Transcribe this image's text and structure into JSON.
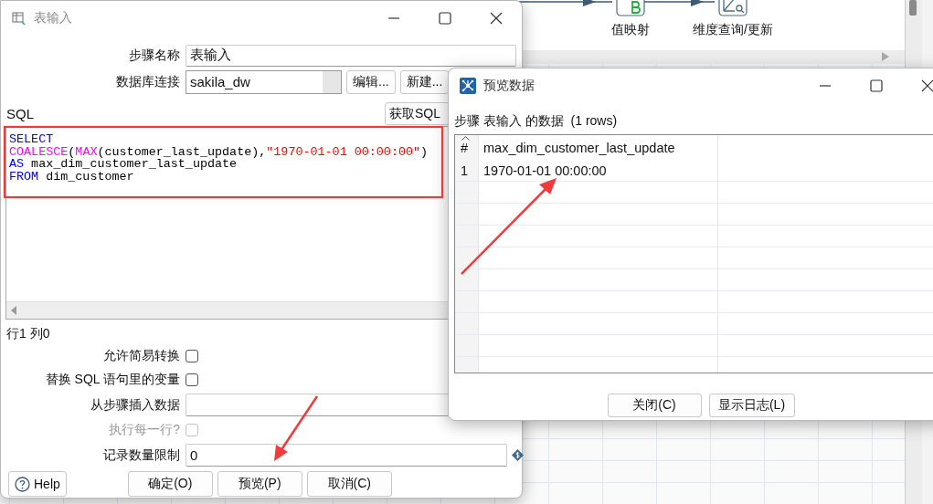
{
  "canvas": {
    "steps": [
      {
        "label": "值映射",
        "kind": "value-mapper"
      },
      {
        "label": "维度查询/更新",
        "kind": "dimension-lookup"
      }
    ]
  },
  "dialog": {
    "title": "表输入",
    "step_name": {
      "label": "步骤名称",
      "value": "表输入"
    },
    "connection": {
      "label": "数据库连接",
      "value": "sakila_dw"
    },
    "connection_buttons": [
      "编辑...",
      "新建..."
    ],
    "sql_label": "SQL",
    "get_sql_button": "获取SQL",
    "sql_lines": [
      [
        {
          "text": "SELECT",
          "kind": "keyword"
        }
      ],
      [
        {
          "text": "COALESCE",
          "kind": "function"
        },
        {
          "text": "(",
          "kind": "plain"
        },
        {
          "text": "MAX",
          "kind": "function"
        },
        {
          "text": "(customer_last_update),",
          "kind": "plain"
        },
        {
          "text": "\"1970-01-01 00:00:00\"",
          "kind": "string"
        },
        {
          "text": ")",
          "kind": "plain"
        }
      ],
      [
        {
          "text": "AS",
          "kind": "keyword"
        },
        {
          "text": " max_dim_customer_last_update",
          "kind": "plain"
        }
      ],
      [
        {
          "text": "FROM",
          "kind": "keyword"
        },
        {
          "text": " dim_customer",
          "kind": "plain"
        }
      ]
    ],
    "cursor_position": "行1 列0",
    "options": [
      {
        "kind": "checkbox",
        "label": "允许简易转换",
        "checked": false,
        "disabled": false
      },
      {
        "kind": "checkbox",
        "label": "替换 SQL 语句里的变量",
        "checked": false,
        "disabled": false
      },
      {
        "kind": "field",
        "label": "从步骤插入数据"
      },
      {
        "kind": "checkbox",
        "label": "执行每一行?",
        "checked": false,
        "disabled": true
      },
      {
        "kind": "field",
        "label": "记录数量限制",
        "value": "0",
        "variable": true
      }
    ],
    "help_button": "Help",
    "buttons": [
      "确定(O)",
      "预览(P)",
      "取消(C)"
    ]
  },
  "preview": {
    "title": "预览数据",
    "caption": "步骤 表输入 的数据  (1 rows)",
    "table": {
      "columns": [
        "#",
        "max_dim_customer_last_update"
      ],
      "rows": [
        [
          "1",
          "1970-01-01 00:00:00"
        ]
      ]
    },
    "buttons": [
      "关闭(C)",
      "显示日志(L)"
    ]
  }
}
